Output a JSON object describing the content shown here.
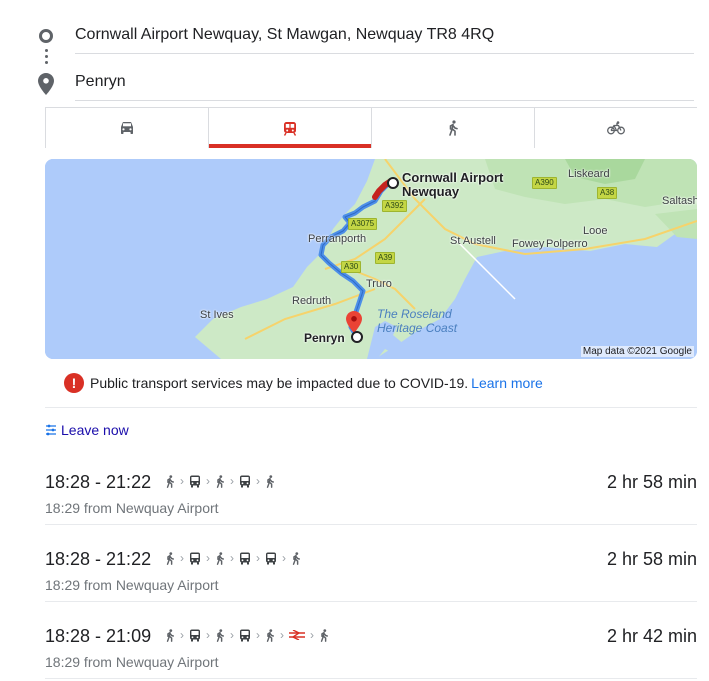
{
  "route": {
    "origin": "Cornwall Airport Newquay, St Mawgan, Newquay TR8 4RQ",
    "destination": "Penryn"
  },
  "modes": [
    {
      "name": "driving",
      "icon": "car-icon",
      "active": false
    },
    {
      "name": "transit",
      "icon": "train-icon",
      "active": true
    },
    {
      "name": "walking",
      "icon": "walking-icon",
      "active": false
    },
    {
      "name": "cycling",
      "icon": "bicycle-icon",
      "active": false
    }
  ],
  "map": {
    "labels": {
      "origin": [
        "Cornwall Airport",
        "Newquay"
      ],
      "destination": "Penryn",
      "towns": [
        "Liskeard",
        "Saltash",
        "Perranporth",
        "St Austell",
        "Fowey",
        "Polperro",
        "Looe",
        "Truro",
        "Redruth",
        "St Ives"
      ],
      "area": [
        "The Roseland",
        "Heritage Coast"
      ]
    },
    "roads": [
      "A390",
      "A38",
      "A392",
      "A3075",
      "A39",
      "A30"
    ],
    "attribution": "Map data ©2021 Google"
  },
  "alert": {
    "text": "Public transport services may be impacted due to COVID-19.",
    "link": "Learn more"
  },
  "leave_now": "Leave now",
  "trips": [
    {
      "time": "18:28 - 21:22",
      "duration": "2 hr 58 min",
      "from": "18:29 from Newquay Airport",
      "steps": [
        "walk",
        "bus",
        "walk",
        "bus",
        "walk"
      ]
    },
    {
      "time": "18:28 - 21:22",
      "duration": "2 hr 58 min",
      "from": "18:29 from Newquay Airport",
      "steps": [
        "walk",
        "bus",
        "walk",
        "bus",
        "bus",
        "walk"
      ]
    },
    {
      "time": "18:28 - 21:09",
      "duration": "2 hr 42 min",
      "from": "18:29 from Newquay Airport",
      "steps": [
        "walk",
        "bus",
        "walk",
        "bus",
        "walk",
        "rail",
        "walk"
      ]
    }
  ],
  "colors": {
    "accent": "#d93025",
    "link": "#1a73e8",
    "route": "#4d8fe8"
  }
}
